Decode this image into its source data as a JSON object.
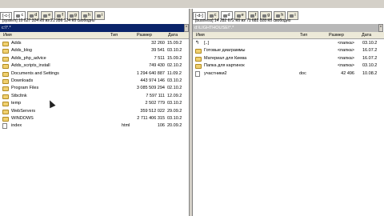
{
  "left_panel": {
    "drives": [
      "c",
      "d",
      "e",
      "f",
      "g",
      "h",
      "i"
    ],
    "active_drive": "c",
    "drive_select": "[-c-]",
    "volume_info": "[system]  10 827 324 Кб из 21 286 124 Кб свободно",
    "path": "c:\\*.*",
    "headers": {
      "name": "Имя",
      "type": "Тип",
      "size": "Размер",
      "date": "Дата"
    },
    "rows": [
      {
        "icon": "folder",
        "name": "Adds",
        "type": "",
        "size": "32 260",
        "date": "15.09.2"
      },
      {
        "icon": "folder",
        "name": "Adds_blog",
        "type": "",
        "size": "39 541",
        "date": "03.10.2"
      },
      {
        "icon": "folder",
        "name": "Adds_php_advice",
        "type": "",
        "size": "7 511",
        "date": "15.09.2"
      },
      {
        "icon": "folder",
        "name": "Adds_scripts_install",
        "type": "",
        "size": "749 430",
        "date": "02.10.2"
      },
      {
        "icon": "folder",
        "name": "Documents and Settings",
        "type": "",
        "size": "1 294 640 887",
        "date": "11.09.2"
      },
      {
        "icon": "folder",
        "name": "Downloads",
        "type": "",
        "size": "443 974 146",
        "date": "03.10.2"
      },
      {
        "icon": "folder",
        "name": "Program Files",
        "type": "",
        "size": "3 085 509 294",
        "date": "02.10.2"
      },
      {
        "icon": "folder",
        "name": "Stbcltnk",
        "type": "",
        "size": "7 597 111",
        "date": "12.09.2"
      },
      {
        "icon": "folder",
        "name": "temp",
        "type": "",
        "size": "2 502 779",
        "date": "03.10.2"
      },
      {
        "icon": "folder",
        "name": "WebServers",
        "type": "",
        "size": "359 512 022",
        "date": "29.09.2"
      },
      {
        "icon": "folder",
        "name": "WINDOWS",
        "type": "",
        "size": "2 711 406 315",
        "date": "03.10.2"
      },
      {
        "icon": "file",
        "name": "index",
        "type": "html",
        "size": "106",
        "date": "20.09.2"
      }
    ]
  },
  "right_panel": {
    "drives": [
      "c",
      "d",
      "e",
      "f",
      "g",
      "h",
      "i"
    ],
    "active_drive": "d",
    "drive_select": "[-d-]",
    "volume_info": "[business]  14 282 672 Кб из 71 682 028 Кб свободно",
    "path": "d:\\LIGHTHOUSE\\*.*",
    "headers": {
      "name": "Имя",
      "type": "Тип",
      "size": "Размер",
      "date": "Дата"
    },
    "rows": [
      {
        "icon": "up",
        "name": "[..]",
        "type": "",
        "size": "<папка>",
        "date": "03.10.2"
      },
      {
        "icon": "folder",
        "name": "Готовые диаграммы",
        "type": "",
        "size": "<папка>",
        "date": "16.07.2"
      },
      {
        "icon": "folder",
        "name": "Материал для Киева",
        "type": "",
        "size": "<папка>",
        "date": "16.07.2"
      },
      {
        "icon": "folder",
        "name": "Папка для картинок",
        "type": "",
        "size": "<папка>",
        "date": "03.10.2"
      },
      {
        "icon": "file",
        "name": "участники2",
        "type": "doc",
        "size": "42 496",
        "date": "10.08.2"
      }
    ]
  }
}
